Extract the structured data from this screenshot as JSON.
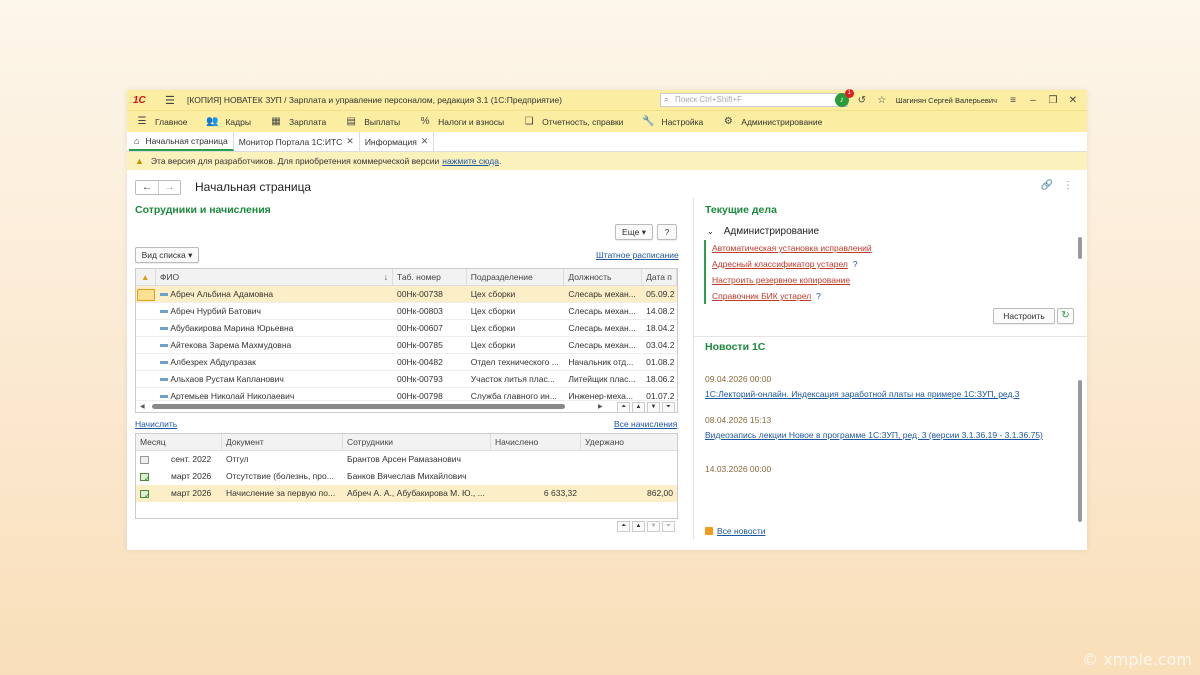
{
  "app": {
    "logo": "1С",
    "title": "[КОПИЯ] НОВАТЕК ЗУП / Зарплата и управление персоналом, редакция 3.1  (1С:Предприятие)",
    "search_placeholder": "Поиск Ctrl+Shift+F",
    "notifications_count": "1",
    "user": "Шагинян Сергей Валерьевич"
  },
  "sections": [
    {
      "label": "Главное",
      "icon": "hamburger-icon"
    },
    {
      "label": "Кадры",
      "icon": "people-icon"
    },
    {
      "label": "Зарплата",
      "icon": "calculator-icon"
    },
    {
      "label": "Выплаты",
      "icon": "wallet-icon"
    },
    {
      "label": "Налоги и взносы",
      "icon": "percent-icon"
    },
    {
      "label": "Отчетность, справки",
      "icon": "report-icon"
    },
    {
      "label": "Настройка",
      "icon": "wrench-icon"
    },
    {
      "label": "Администрирование",
      "icon": "gear-icon"
    }
  ],
  "tabs": [
    {
      "label": "Начальная страница"
    },
    {
      "label": "Монитор Портала 1С:ИТС"
    },
    {
      "label": "Информация"
    }
  ],
  "warning": {
    "text": "Эта версия для разработчиков. Для приобретения коммерческой версии",
    "link": "нажмите сюда",
    "tail": "."
  },
  "page": {
    "title": "Начальная страница"
  },
  "employees": {
    "title": "Сотрудники и начисления",
    "more_button": "Еще",
    "help_button": "?",
    "view_button": "Вид списка",
    "staff_link": "Штатное расписание",
    "columns": [
      "ФИО",
      "Таб. номер",
      "Подразделение",
      "Должность",
      "Дата п"
    ],
    "rows": [
      [
        "Абреч Альбина Адамовна",
        "00Нк-00738",
        "Цех сборки",
        "Слесарь механ...",
        "05.09.2"
      ],
      [
        "Абреч Нурбий Батович",
        "00Нк-00803",
        "Цех сборки",
        "Слесарь механ...",
        "14.08.2"
      ],
      [
        "Абубакирова Марина Юрьевна",
        "00Нк-00607",
        "Цех сборки",
        "Слесарь механ...",
        "18.04.2"
      ],
      [
        "Айтекова Зарема Махмудовна",
        "00Нк-00785",
        "Цех сборки",
        "Слесарь механ...",
        "03.04.2"
      ],
      [
        "Албезрех Абдулразак",
        "00Нк-00482",
        "Отдел технического ...",
        "Начальник отд...",
        "01.08.2"
      ],
      [
        "Альхаов Рустам Капланович",
        "00Нк-00793",
        "Участок литья плас...",
        "Литейщик плас...",
        "18.06.2"
      ],
      [
        "Артемьев Николай Николаевич",
        "00Нк-00798",
        "Служба главного ин...",
        "Инженер-меха...",
        "01.07.2"
      ]
    ],
    "accrue_link": "Начислить",
    "all_accruals_link": "Все начисления"
  },
  "accruals": {
    "columns": [
      "Месяц",
      "Документ",
      "Сотрудники",
      "Начислено",
      "Удержано"
    ],
    "rows": [
      [
        "сент. 2022",
        "Отгул",
        "Брантов Арсен Рамазанович",
        "",
        ""
      ],
      [
        "март 2026",
        "Отсутствие (болезнь, про...",
        "Банков Вячеслав Михайлович",
        "",
        ""
      ],
      [
        "март 2026",
        "Начисление за первую по...",
        "Абреч А. А., Абубакирова М. Ю., ...",
        "6 633,32",
        "862,00"
      ]
    ]
  },
  "todo": {
    "title": "Текущие дела",
    "group": "Администрирование",
    "items": [
      {
        "label": "Автоматическая установка исправлений",
        "help": ""
      },
      {
        "label": "Адресный классификатор устарел",
        "help": "?"
      },
      {
        "label": "Настроить резервное копирование",
        "help": ""
      },
      {
        "label": "Справочник БИК устарел",
        "help": "?"
      }
    ],
    "configure_button": "Настроить"
  },
  "news": {
    "title": "Новости 1С",
    "items": [
      {
        "date": "09.04.2026 00:00",
        "title": "1С:Лекторий-онлайн. Индексация заработной платы на примере 1С:ЗУП, ред.3"
      },
      {
        "date": "08.04.2026 15:13",
        "title": "Видеозапись лекции  Новое в программе 1С:ЗУП, ред. 3 (версии 3.1.36.19 - 3.1.36.75)"
      },
      {
        "date": "14.03.2026 00:00",
        "title": ""
      }
    ],
    "all_link": "Все новости"
  },
  "watermark": "© xmple.com"
}
